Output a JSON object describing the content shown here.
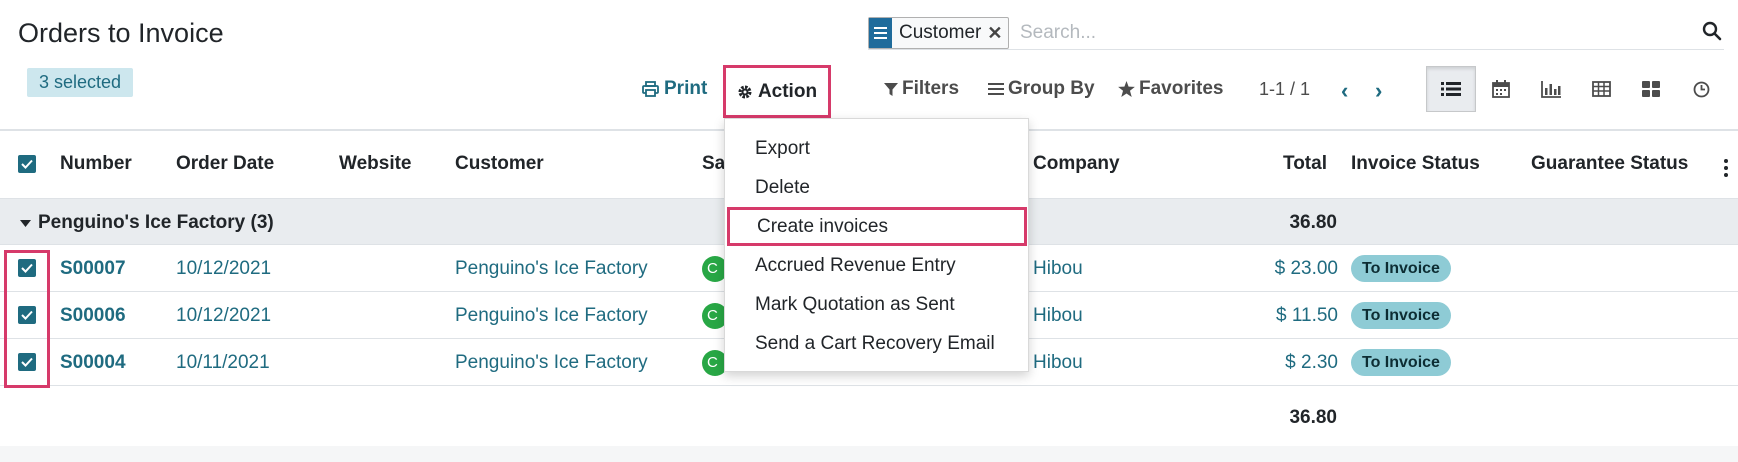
{
  "page": {
    "title": "Orders to Invoice",
    "selected_count_label": "3 selected"
  },
  "search": {
    "facet_label": "Customer",
    "placeholder": "Search..."
  },
  "toolbar": {
    "print_label": "Print",
    "action_label": "Action"
  },
  "filters": {
    "filters_label": "Filters",
    "group_by_label": "Group By",
    "favorites_label": "Favorites"
  },
  "pager": {
    "value": "1-1 / 1"
  },
  "views": [
    "list-view-icon",
    "calendar-view-icon",
    "graph-view-icon",
    "pivot-view-icon",
    "kanban-view-icon",
    "activity-view-icon"
  ],
  "columns": {
    "number": "Number",
    "order_date": "Order Date",
    "website": "Website",
    "customer": "Customer",
    "salesperson_partial": "Sa",
    "company": "Company",
    "total": "Total",
    "invoice_status": "Invoice Status",
    "guarantee_status": "Guarantee Status"
  },
  "group": {
    "label": "Penguino's Ice Factory (3)",
    "total": "36.80"
  },
  "rows": [
    {
      "number": "S00007",
      "date": "10/12/2021",
      "customer": "Penguino's Ice Factory",
      "avatar": "C",
      "company": "Hibou",
      "total": "$ 23.00",
      "status": "To Invoice"
    },
    {
      "number": "S00006",
      "date": "10/12/2021",
      "customer": "Penguino's Ice Factory",
      "avatar": "C",
      "company": "Hibou",
      "total": "$ 11.50",
      "status": "To Invoice"
    },
    {
      "number": "S00004",
      "date": "10/11/2021",
      "customer": "Penguino's Ice Factory",
      "avatar": "C",
      "company": "Hibou",
      "total": "$ 2.30",
      "status": "To Invoice"
    }
  ],
  "footer": {
    "total": "36.80"
  },
  "action_menu": {
    "items": [
      "Export",
      "Delete",
      "Create invoices",
      "Accrued Revenue Entry",
      "Mark Quotation as Sent",
      "Send a Cart Recovery Email"
    ]
  },
  "colors": {
    "primary": "#1f6b80",
    "highlight": "#d63a6a",
    "badge": "#8ecbd5"
  }
}
